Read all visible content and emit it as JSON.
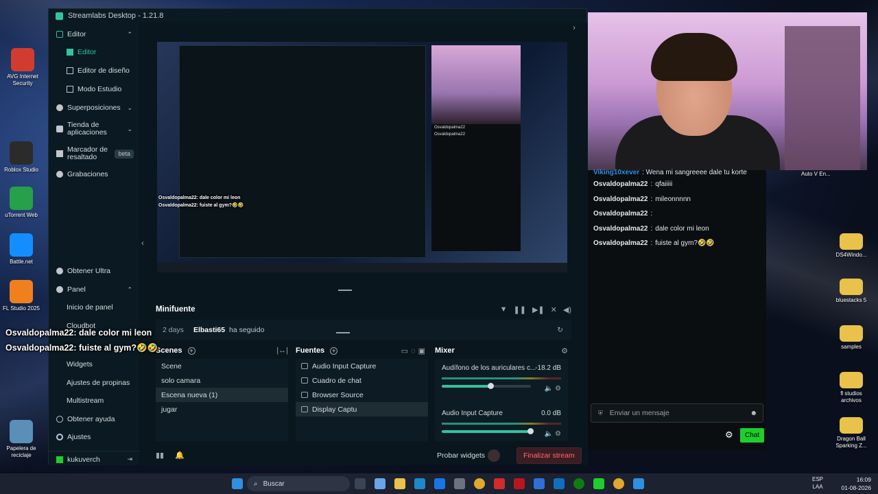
{
  "app": {
    "title": "Streamlabs Desktop - 1.21.8"
  },
  "sidebar": {
    "sections": [
      {
        "label": "Editor"
      },
      {
        "label": "Superposiciones"
      },
      {
        "label": "Tienda de aplicaciones"
      },
      {
        "label": "Marcador de resaltado",
        "badge": "beta"
      },
      {
        "label": "Grabaciones"
      },
      {
        "label": "Obtener Ultra"
      },
      {
        "label": "Panel"
      }
    ],
    "editor_items": [
      "Editor",
      "Editor de diseño",
      "Modo Estudio"
    ],
    "panel_items": [
      "Inicio de panel",
      "Cloudbot",
      "Widgets",
      "Ajustes de propinas",
      "Multistream"
    ],
    "help": "Obtener ayuda",
    "settings": "Ajustes",
    "user": "kukuverch"
  },
  "minifeed": {
    "title": "Minifuente",
    "event": {
      "time": "2 days",
      "user": "Elbasti65",
      "action": "ha seguido"
    }
  },
  "scenes": {
    "title": "Scenes",
    "items": [
      "Scene",
      "solo camara",
      "Escena nueva (1)",
      "jugar"
    ],
    "selected_index": 2
  },
  "sources": {
    "title": "Fuentes",
    "items": [
      "Audio Input Capture",
      "Cuadro de chat",
      "Browser Source",
      "Display Captu"
    ],
    "selected_index": 3
  },
  "mixer": {
    "title": "Mixer",
    "items": [
      {
        "name": "Audífono de los auriculares c...",
        "db": "-18.2 dB",
        "level": 0.55
      },
      {
        "name": "Audio Input Capture",
        "db": "0.0 dB",
        "level": 1.0
      }
    ]
  },
  "footer": {
    "test_widgets": "Probar widgets",
    "go_live": "Finalizar stream"
  },
  "chat": {
    "first_user": "Viking10xever",
    "first_text": "Wena mi sangreeee dale tu korte",
    "messages": [
      {
        "user": "Osvaldopalma22",
        "text": "qfaiiiii"
      },
      {
        "user": "Osvaldopalma22",
        "text": "mileonnnnn"
      },
      {
        "user": "Osvaldopalma22",
        "text": ""
      },
      {
        "user": "Osvaldopalma22",
        "text": "dale color mi leon"
      },
      {
        "user": "Osvaldopalma22",
        "text": "fuiste al gym?🤣🤣"
      }
    ],
    "input_placeholder": "Enviar un mensaje",
    "send_label": "Chat"
  },
  "overlay": {
    "line1": "Osvaldopalma22: dale color mi leon",
    "line2": "Osvaldopalma22: fuiste al gym?🤣🤣"
  },
  "desktop_icons_left": [
    {
      "label": "AVG Internet Security",
      "color": "#d23c2f"
    },
    {
      "label": "Roblox Studio",
      "color": "#2b2b2b"
    },
    {
      "label": "uTorrent Web",
      "color": "#26a04b"
    },
    {
      "label": "Battle.net",
      "color": "#148eff"
    },
    {
      "label": "FL Studio 2025",
      "color": "#f0801e"
    },
    {
      "label": "Papelera de reciclaje",
      "color": "#5a8fb8"
    }
  ],
  "desktop_icons_right": [
    {
      "label": "DS4Windo...",
      "color": "#e8c24a"
    },
    {
      "label": "bluestacks 5",
      "color": "#e8c24a"
    },
    {
      "label": "samples",
      "color": "#e8c24a"
    },
    {
      "label": "fl studios archivos",
      "color": "#e8c24a"
    },
    {
      "label": "Dragon Ball Sparking Z...",
      "color": "#e8c24a"
    }
  ],
  "desktop_tail": {
    "partial": "Auto V En..."
  },
  "taskbar": {
    "search": "Buscar",
    "lang_top": "ESP",
    "lang_bottom": "LAA",
    "time": "16:09",
    "date": "01-08-2026"
  }
}
